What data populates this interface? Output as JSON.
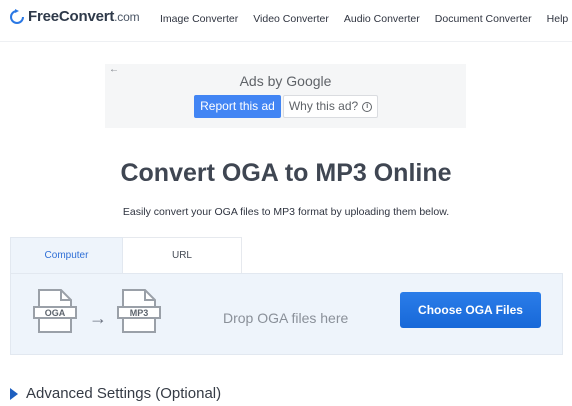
{
  "header": {
    "logo": {
      "part1": "Free",
      "part2": "Convert",
      "part3": ".com"
    },
    "nav": [
      "Image Converter",
      "Video Converter",
      "Audio Converter",
      "Document Converter",
      "Help"
    ]
  },
  "ad": {
    "back_glyph": "←",
    "label": "Ads by Google",
    "report_label": "Report this ad",
    "why_label": "Why this ad?",
    "info_glyph": "i"
  },
  "main": {
    "title": "Convert OGA to MP3 Online",
    "subtitle": "Easily convert your OGA files to MP3 format by uploading them below."
  },
  "tabs": [
    "Computer",
    "URL"
  ],
  "drop": {
    "from_format": "OGA",
    "to_format": "MP3",
    "arrow": "→",
    "text": "Drop OGA files here",
    "button_label": "Choose OGA Files"
  },
  "advanced": {
    "label": "Advanced Settings (Optional)"
  },
  "colors": {
    "accent": "#1a73e8",
    "ad_blue": "#4285f4",
    "tab_active": "#2f6fd6",
    "advanced_icon": "#1d5fbf"
  },
  "icons": {
    "logo": "refresh-icon",
    "file": "document-icon",
    "arrow": "right-arrow-icon",
    "advanced": "caret-right-icon",
    "info": "info-icon"
  }
}
